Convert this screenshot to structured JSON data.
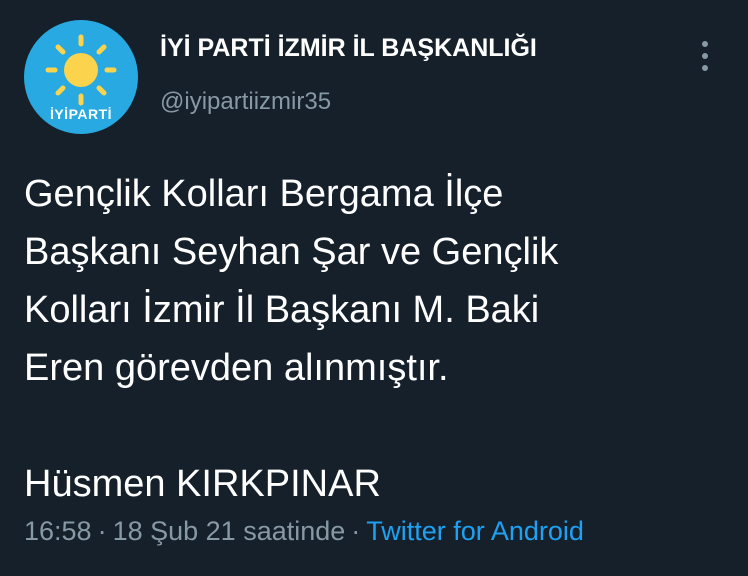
{
  "account": {
    "display_name": "İYİ PARTİ İZMİR İL BAŞKANLIĞI",
    "handle": "@iyipartiizmir35",
    "avatar_text": "İYİPARTİ",
    "avatar_icon": "sun-logo-icon"
  },
  "tweet": {
    "lines": [
      "Gençlik Kolları Bergama İlçe",
      "Başkanı Seyhan Şar ve Gençlik",
      "Kolları İzmir İl Başkanı M. Baki",
      "Eren görevden alınmıştır.",
      "",
      "Hüsmen KIRKPINAR"
    ]
  },
  "meta": {
    "time": "16:58",
    "separator": "·",
    "date": "18 Şub 21 saatinde",
    "source": "Twitter for Android"
  },
  "icons": {
    "more": "more-vertical-icon"
  },
  "colors": {
    "background": "#15202b",
    "text": "#ffffff",
    "secondary_text": "#8899a6",
    "link": "#1da1f2",
    "avatar_bg": "#29a9e1",
    "sun": "#fcd34d"
  }
}
